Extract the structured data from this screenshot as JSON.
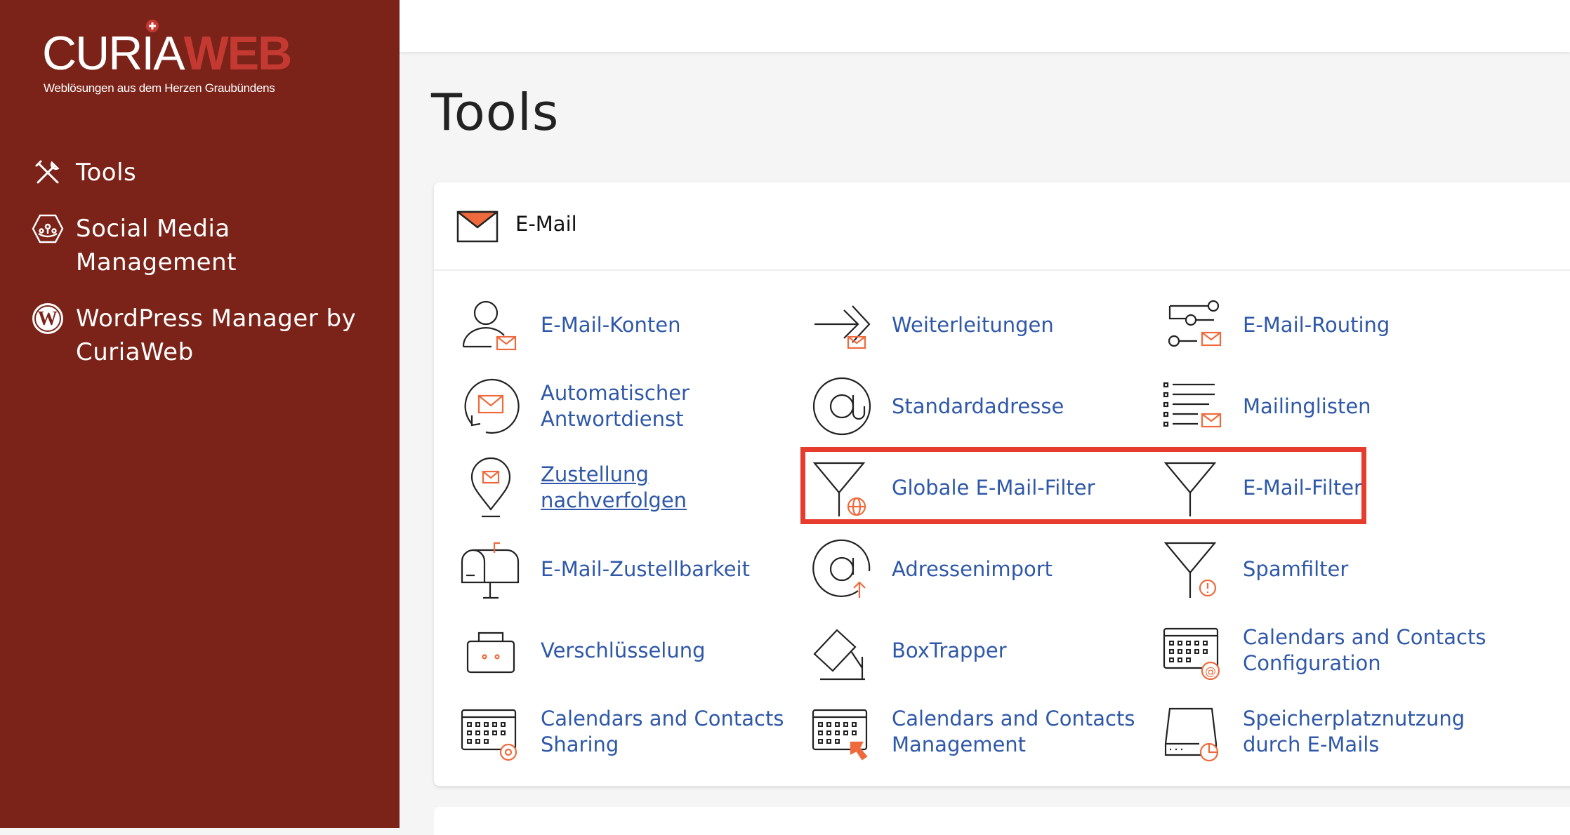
{
  "brand": {
    "logo_primary": "CURIA",
    "logo_secondary": "WEB",
    "tagline": "Weblösungen aus dem Herzen Graubündens"
  },
  "sidebar": {
    "items": [
      {
        "label": "Tools",
        "icon": "tools-icon"
      },
      {
        "label": "Social Media Management",
        "icon": "social-media-icon"
      },
      {
        "label": "WordPress Manager by CuriaWeb",
        "icon": "wordpress-icon"
      }
    ]
  },
  "page": {
    "title": "Tools"
  },
  "email_section": {
    "title": "E-Mail",
    "icon": "envelope-icon",
    "tools": [
      {
        "label": "E-Mail-Konten",
        "icon": "email-accounts-icon"
      },
      {
        "label": "Weiterleitungen",
        "icon": "forwarders-icon"
      },
      {
        "label": "E-Mail-Routing",
        "icon": "email-routing-icon"
      },
      {
        "label": "Automatischer Antwortdienst",
        "icon": "autoresponder-icon"
      },
      {
        "label": "Standardadresse",
        "icon": "default-address-icon"
      },
      {
        "label": "Mailinglisten",
        "icon": "mailing-lists-icon"
      },
      {
        "label": "Zustellung nachverfolgen",
        "icon": "track-delivery-icon"
      },
      {
        "label": "Globale E-Mail-Filter",
        "icon": "global-email-filter-icon"
      },
      {
        "label": "E-Mail-Filter",
        "icon": "email-filter-icon"
      },
      {
        "label": "E-Mail-Zustellbarkeit",
        "icon": "email-deliverability-icon"
      },
      {
        "label": "Adressenimport",
        "icon": "address-import-icon"
      },
      {
        "label": "Spamfilter",
        "icon": "spam-filter-icon"
      },
      {
        "label": "Verschlüsselung",
        "icon": "encryption-icon"
      },
      {
        "label": "BoxTrapper",
        "icon": "boxtrapper-icon"
      },
      {
        "label": "Calendars and Contacts Configuration",
        "icon": "calendar-config-icon"
      },
      {
        "label": "Calendars and Contacts Sharing",
        "icon": "calendar-sharing-icon"
      },
      {
        "label": "Calendars and Contacts Management",
        "icon": "calendar-management-icon"
      },
      {
        "label": "Speicherplatznutzung durch E-Mails",
        "icon": "disk-usage-icon"
      }
    ]
  },
  "colors": {
    "sidebar_bg": "#7b2319",
    "link": "#2f58a8",
    "accent_orange": "#ee6a3c",
    "highlight": "#e53c2d"
  }
}
